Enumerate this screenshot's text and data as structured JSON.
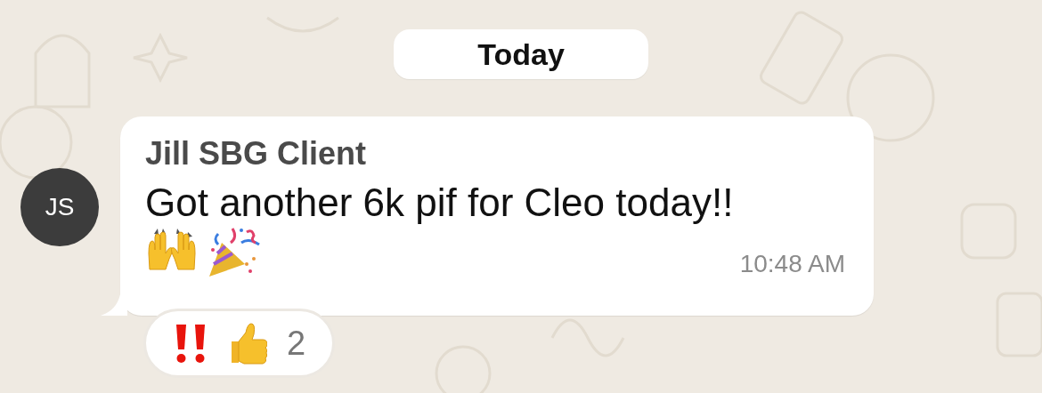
{
  "date_divider": "Today",
  "message": {
    "avatar_initials": "JS",
    "sender": "Jill SBG Client",
    "text": "Got another 6k pif for Cleo today!!",
    "emojis": [
      {
        "kind": "raised-hands"
      },
      {
        "kind": "party-popper"
      }
    ],
    "time": "10:48 AM"
  },
  "reactions": {
    "items": [
      {
        "kind": "double-exclamation"
      },
      {
        "kind": "thumbs-up"
      }
    ],
    "count": "2"
  }
}
